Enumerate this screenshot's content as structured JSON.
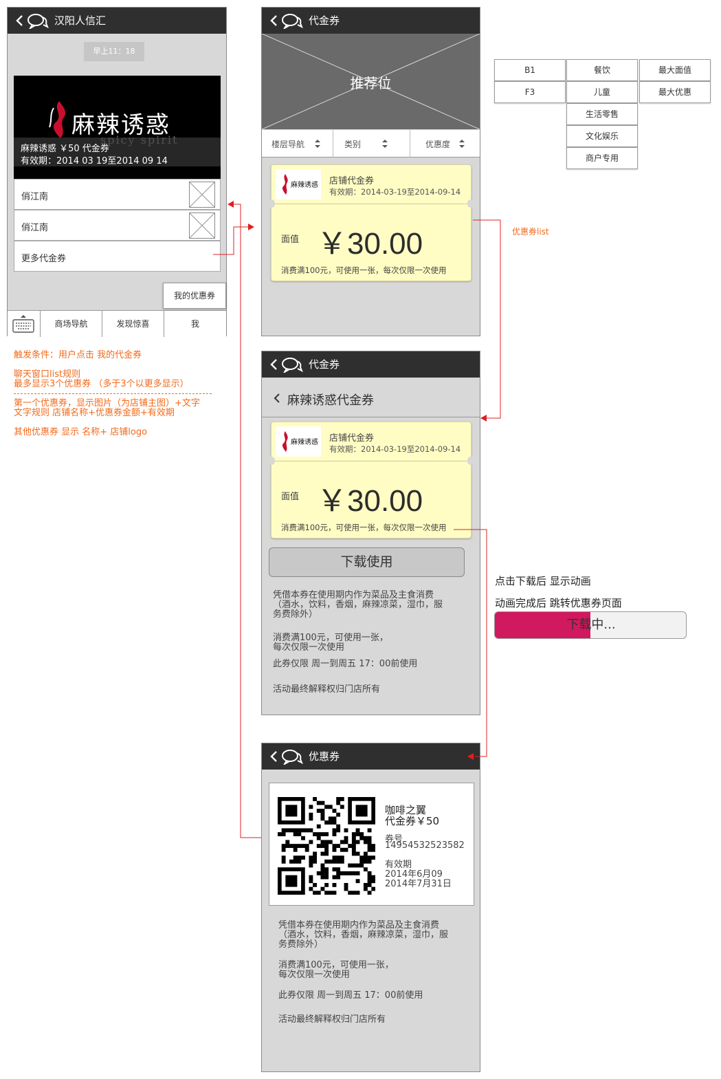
{
  "screen1": {
    "title": "汉阳人信汇",
    "timestamp": "早上11：18",
    "banner": {
      "brand_cn": "麻辣诱惑",
      "brand_en": "spicy spirit",
      "line1": "麻辣诱惑 ￥50 代金券",
      "line2": "有效期：2014 03 19至2014 09 14"
    },
    "list": [
      {
        "label": "俏江南"
      },
      {
        "label": "俏江南"
      }
    ],
    "more_label": "更多代金券",
    "popup_label": "我的优惠券",
    "tabs": [
      "商场导航",
      "发现惊喜",
      "我"
    ]
  },
  "notes_left": {
    "trigger": "触发条件：用户点击 我的代金券",
    "rule_title": "聊天窗口list规则",
    "rule_max": "最多显示3个优惠券 （多于3个以更多显示）",
    "first_line1": "第一个优惠券，显示图片（为店铺主图）+文字",
    "first_line2": "文字规则  店铺名称+优惠券金额+有效期",
    "other": "其他优惠券  显示 名称+ 店铺logo"
  },
  "screen2": {
    "title": "代金券",
    "recommend": "推荐位",
    "filters": [
      "楼层导航",
      "类别",
      "优惠度"
    ],
    "coupon": {
      "name": "店铺代金券",
      "valid": "有效期：2014-03-19至2014-09-14",
      "face_label": "面值",
      "amount": "￥30.00",
      "rule": "消费满100元，可使用一张，每次仅限一次使用"
    }
  },
  "dropdown": {
    "col1": [
      "B1",
      "F3"
    ],
    "col2": [
      "餐饮",
      "儿童",
      "生活零售",
      "文化娱乐",
      "商户专用"
    ],
    "col3": [
      "最大面值",
      "最大优惠"
    ]
  },
  "note_list": "优惠券list",
  "screen3": {
    "title": "代金券",
    "sub_title": "麻辣诱惑代金券",
    "coupon": {
      "name": "店铺代金券",
      "valid": "有效期：2014-03-19至2014-09-14",
      "face_label": "面值",
      "amount": "￥30.00",
      "rule": "消费满100元，可使用一张，每次仅限一次使用"
    },
    "download_label": "下载使用",
    "desc1a": "凭借本券在使用期内作为菜品及主食消费",
    "desc1b": "（酒水，饮料，香烟，麻辣凉菜，湿巾，服",
    "desc1c": "务费除外）",
    "desc2a": "消费满100元，可使用一张，",
    "desc2b": "每次仅限一次使用",
    "desc3": "此券仅限 周一到周五 17：00前使用",
    "desc4": "活动最终解释权归门店所有"
  },
  "notes_right": {
    "line1": "点击下载后  显示动画",
    "line2": "动画完成后 跳转优惠券页面",
    "progress_label": "下载中...",
    "progress": 0.5
  },
  "screen4": {
    "title": "优惠券",
    "shop": "咖啡之翼",
    "voucher": "代金券￥50",
    "code_label": "券号",
    "code": "14954532523582",
    "valid_label": "有效期",
    "valid_from": "2014年6月09",
    "valid_to": "2014年7月31日",
    "desc1a": "凭借本券在使用期内作为菜品及主食消费",
    "desc1b": "（酒水，饮料，香烟，麻辣凉菜，湿巾，服",
    "desc1c": "务费除外）",
    "desc2a": "消费满100元，可使用一张，",
    "desc2b": "每次仅限一次使用",
    "desc3": "此券仅限 周一到周五 17：00前使用",
    "desc4": "活动最终解释权归门店所有"
  },
  "colors": {
    "header": "#2f2f2f",
    "annotation": "#f26a1b",
    "arrow": "#e02020",
    "coupon": "#fffdc4",
    "progress": "#d0195e"
  }
}
